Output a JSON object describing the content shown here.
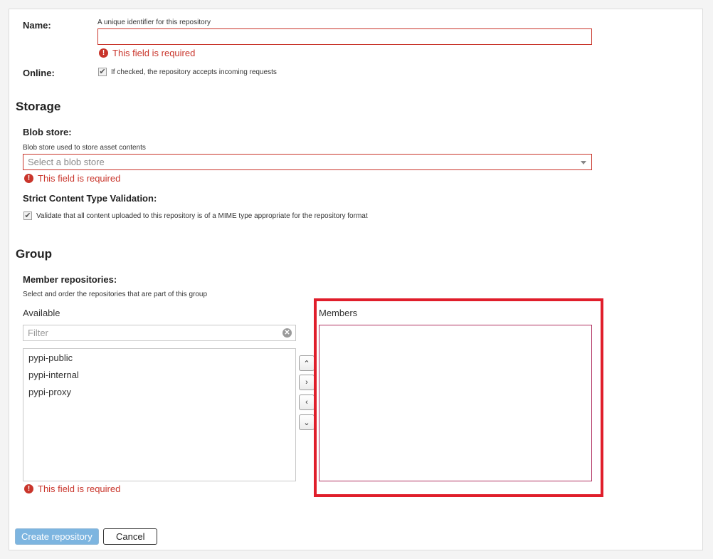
{
  "name_field": {
    "label": "Name:",
    "help": "A unique identifier for this repository",
    "value": "",
    "error": "This field is required"
  },
  "online_field": {
    "label": "Online:",
    "checked": true,
    "help": "If checked, the repository accepts incoming requests"
  },
  "storage": {
    "title": "Storage",
    "blob_store": {
      "label": "Blob store:",
      "help": "Blob store used to store asset contents",
      "placeholder": "Select a blob store",
      "error": "This field is required"
    },
    "strict_validation": {
      "label": "Strict Content Type Validation:",
      "checked": true,
      "help": "Validate that all content uploaded to this repository is of a MIME type appropriate for the repository format"
    }
  },
  "group": {
    "title": "Group",
    "member_repositories": {
      "label": "Member repositories:",
      "help": "Select and order the repositories that are part of this group",
      "available_label": "Available",
      "members_label": "Members",
      "filter_placeholder": "Filter",
      "available_items": [
        "pypi-public",
        "pypi-internal",
        "pypi-proxy"
      ],
      "members_items": [],
      "error": "This field is required"
    },
    "move_buttons": {
      "up": "⌃",
      "add": "›",
      "remove": "‹",
      "down": "⌄"
    }
  },
  "actions": {
    "create_label": "Create repository",
    "cancel_label": "Cancel"
  },
  "icons": {
    "error": "exclamation-circle-icon",
    "check": "checkmark-icon",
    "clear": "clear-x-icon",
    "dropdown": "caret-down-icon"
  },
  "colors": {
    "error": "#c9352b",
    "highlight": "#e01e2b",
    "primary_button": "#7db5e0",
    "members_border": "#b03060"
  },
  "glyphs": {
    "error": "!",
    "check": "✔",
    "clear": "✕"
  }
}
